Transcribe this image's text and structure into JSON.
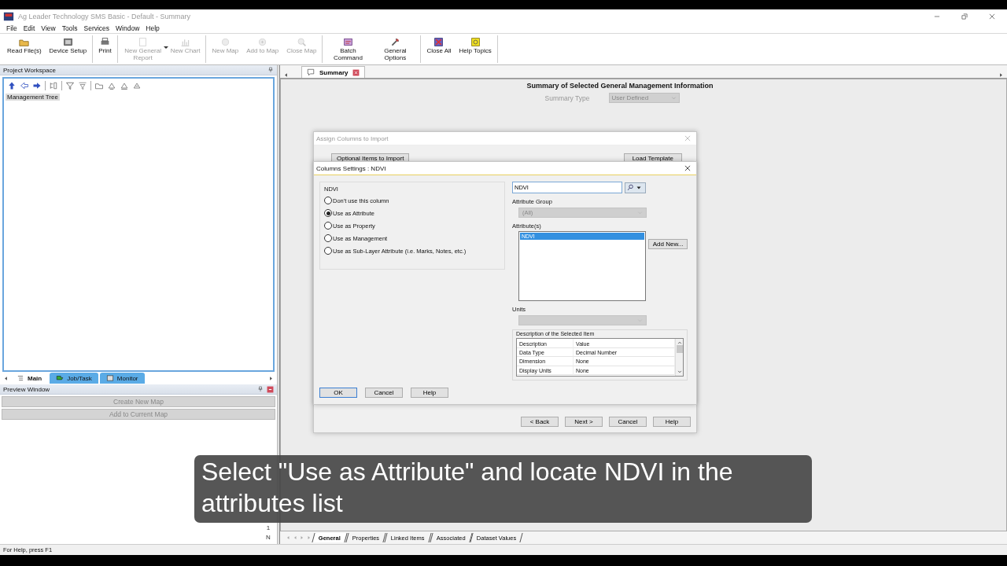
{
  "window": {
    "title": "Ag Leader Technology SMS Basic - Default - Summary"
  },
  "menu": [
    "File",
    "Edit",
    "View",
    "Tools",
    "Services",
    "Window",
    "Help"
  ],
  "toolbar": [
    [
      {
        "label": "Read File(s)",
        "disabled": false
      },
      {
        "label": "Device Setup",
        "disabled": false
      }
    ],
    [
      {
        "label": "Print",
        "disabled": false
      }
    ],
    [
      {
        "label": "New General Report",
        "disabled": true,
        "dropdown": true
      },
      {
        "label": "New Chart",
        "disabled": true
      }
    ],
    [
      {
        "label": "New Map",
        "disabled": true
      },
      {
        "label": "Add to Map",
        "disabled": true
      },
      {
        "label": "Close Map",
        "disabled": true
      }
    ],
    [
      {
        "label": "Batch Command",
        "disabled": false
      },
      {
        "label": "General Options",
        "disabled": false
      }
    ],
    [
      {
        "label": "Close All",
        "disabled": false
      },
      {
        "label": "Help Topics",
        "disabled": false
      }
    ]
  ],
  "workspace": {
    "title": "Project Workspace",
    "tree": [
      {
        "label": "Management Tree",
        "selected": true
      }
    ],
    "tabs": [
      {
        "label": "Main",
        "selected": true
      },
      {
        "label": "Job/Task",
        "selected": false
      },
      {
        "label": "Monitor",
        "selected": false
      }
    ]
  },
  "preview": {
    "title": "Preview Window",
    "buttons": [
      {
        "label": "Create New Map",
        "disabled": true
      },
      {
        "label": "Add to Current Map",
        "disabled": true
      }
    ]
  },
  "document_tabs": [
    {
      "label": "Summary",
      "selected": true
    }
  ],
  "summary": {
    "heading": "Summary of Selected General Management Information",
    "type_label": "Summary Type",
    "type_value": "User Defined"
  },
  "assign_dialog": {
    "title": "Assign Columns to Import",
    "active": false,
    "optional_items": "Optional Items to Import",
    "load_template": "Load Template",
    "buttons": [
      "< Back",
      "Next >",
      "Cancel",
      "Help"
    ]
  },
  "columns_dialog": {
    "title": "Columns Settings : NDVI",
    "group_title": "NDVI",
    "options": [
      {
        "label": "Don't use this column",
        "selected": false
      },
      {
        "label": "Use as Attribute",
        "selected": true
      },
      {
        "label": "Use as Property",
        "selected": false
      },
      {
        "label": "Use as Management",
        "selected": false
      },
      {
        "label": "Use as Sub-Layer Attribute (i.e. Marks, Notes, etc.)",
        "selected": false
      }
    ],
    "search": {
      "value": "NDVI"
    },
    "attribute_group_label": "Attribute Group",
    "attribute_group": {
      "value": "(All)",
      "disabled": true
    },
    "attributes_label": "Attribute(s)",
    "attributes": [
      {
        "label": "NDVI",
        "selected": true
      }
    ],
    "add_new": "Add New...",
    "units_label": "Units",
    "units": {
      "disabled": true
    },
    "description": {
      "title": "Description of the Selected Item",
      "columns": [
        "Description",
        "Value"
      ],
      "rows": [
        [
          "Data Type",
          "Decimal Number"
        ],
        [
          "Dimension",
          "None"
        ],
        [
          "Display Units",
          "None"
        ]
      ]
    },
    "buttons": [
      "OK",
      "Cancel",
      "Help"
    ]
  },
  "sheet_tabs": [
    {
      "label": "General",
      "selected": true
    },
    {
      "label": "Properties",
      "selected": false
    },
    {
      "label": "Linked Items",
      "selected": false
    },
    {
      "label": "Associated",
      "selected": false
    },
    {
      "label": "Dataset Values",
      "selected": false
    }
  ],
  "scale_marks": [
    "1",
    "N"
  ],
  "caption": "Select \"Use as Attribute\" and locate NDVI in the attributes list",
  "status_bar": "For Help, press F1"
}
